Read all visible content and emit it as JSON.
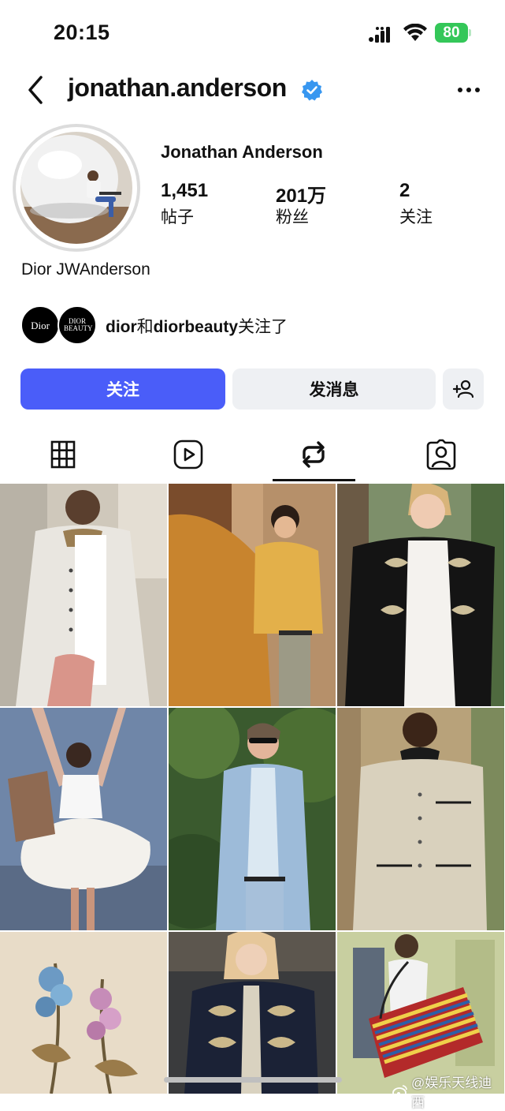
{
  "status_bar": {
    "time": "20:15",
    "battery": "80"
  },
  "header": {
    "username": "jonathan.anderson"
  },
  "profile": {
    "display_name": "Jonathan Anderson",
    "stats": [
      {
        "value": "1,451",
        "label": "帖子"
      },
      {
        "value": "201万",
        "label": "粉丝"
      },
      {
        "value": "2",
        "label": "关注"
      }
    ],
    "bio": "Dior JWAnderson",
    "followed_by": {
      "account_1": "dior",
      "joiner": "和",
      "account_2": "diorbeauty",
      "suffix": "关注了"
    },
    "followed_by_logos": [
      "Dior",
      "DIOR BEAUTY"
    ]
  },
  "actions": {
    "follow_label": "关注",
    "message_label": "发消息"
  },
  "tabs": {
    "active_index": 2
  },
  "watermark": "@娱乐天线迪西",
  "colors": {
    "accent": "#4a5df9",
    "verified": "#3897f0",
    "battery": "#34c759"
  }
}
